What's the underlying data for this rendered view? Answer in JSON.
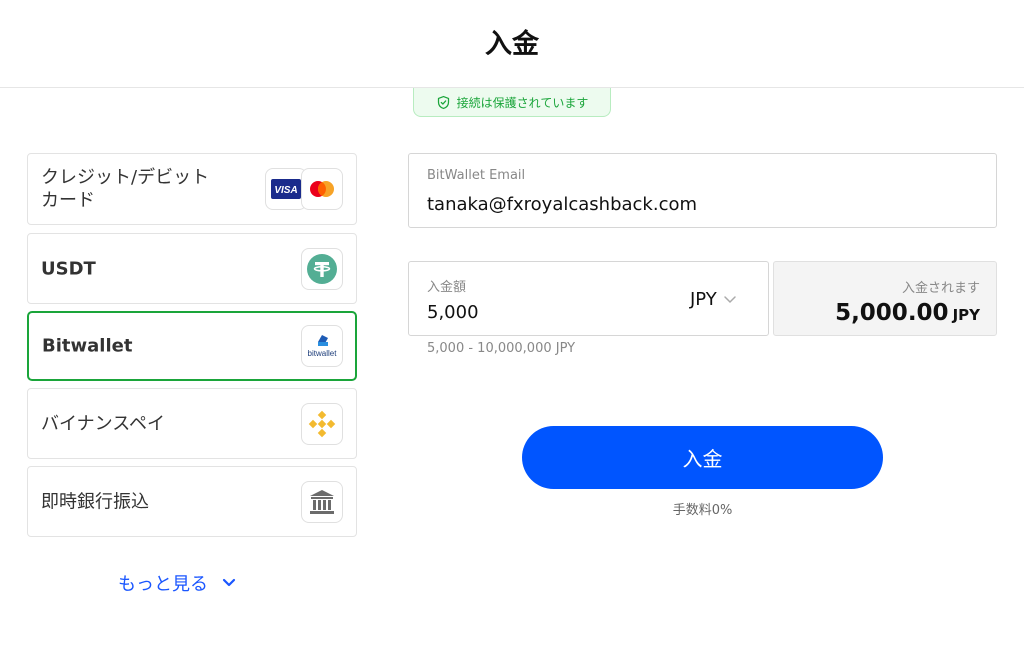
{
  "header": {
    "title": "入金"
  },
  "secure_badge": {
    "text": "接続は保護されています",
    "icon": "shield-check-icon",
    "color": "#1aa53a"
  },
  "methods": [
    {
      "label": "クレジット/デビットカード",
      "icons": [
        "visa-icon",
        "mastercard-icon"
      ],
      "visa_text": "VISA"
    },
    {
      "label": "USDT",
      "icons": [
        "tether-icon"
      ]
    },
    {
      "label": "Bitwallet",
      "icons": [
        "bitwallet-icon"
      ],
      "selected": true,
      "logo_text": "bitwallet"
    },
    {
      "label": "バイナンスペイ",
      "icons": [
        "binance-icon"
      ]
    },
    {
      "label": "即時銀行振込",
      "icons": [
        "bank-icon"
      ]
    }
  ],
  "more_link": {
    "label": "もっと見る",
    "icon": "chevron-down-icon"
  },
  "email_field": {
    "label": "BitWallet Email",
    "value": "tanaka@fxroyalcashback.com"
  },
  "amount_field": {
    "label": "入金額",
    "value": "5,000",
    "currency": "JPY",
    "range": "5,000 - 10,000,000 JPY"
  },
  "received": {
    "label": "入金されます",
    "amount": "5,000.00",
    "currency": "JPY"
  },
  "deposit_button": {
    "label": "入金",
    "color": "#0055ff"
  },
  "fee": {
    "text": "手数料0%"
  },
  "colors": {
    "accent": "#0055ff",
    "selected_border": "#1aa53a",
    "tether": "#53ae94",
    "binance": "#f3ba2f",
    "bitwallet": "#1d5bb5"
  }
}
